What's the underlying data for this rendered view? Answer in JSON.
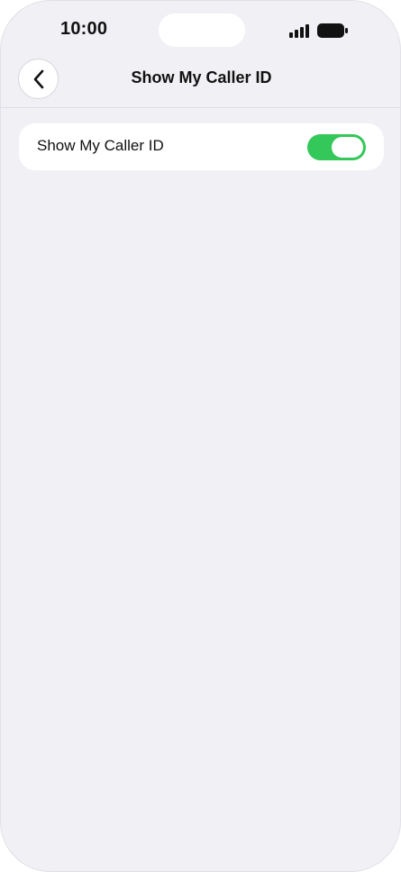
{
  "status_bar": {
    "time": "10:00",
    "signal_icon": "cellular-signal-icon",
    "battery_icon": "battery-icon"
  },
  "nav": {
    "back_icon": "chevron-left-icon",
    "title": "Show My Caller ID"
  },
  "settings": {
    "rows": [
      {
        "label": "Show My Caller ID",
        "toggle_on": true
      }
    ]
  },
  "colors": {
    "background": "#f1f0f5",
    "card": "#ffffff",
    "toggle_on": "#34c759",
    "text": "#111111"
  }
}
